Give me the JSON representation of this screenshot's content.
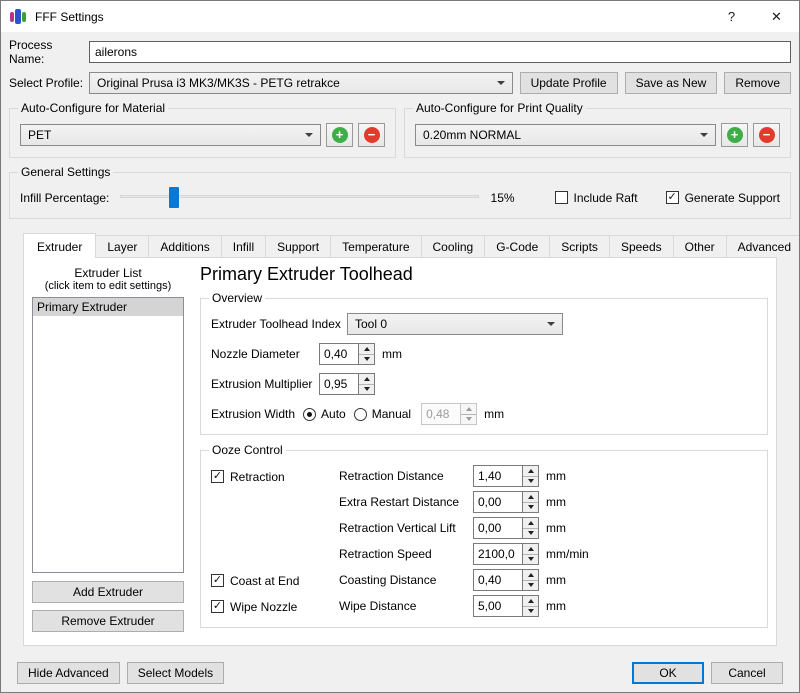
{
  "window": {
    "title": "FFF Settings",
    "help": "?",
    "close": "✕"
  },
  "process": {
    "label": "Process Name:",
    "value": "ailerons"
  },
  "profile": {
    "label": "Select Profile:",
    "value": "Original Prusa i3 MK3/MK3S - PETG retrakce",
    "update": "Update Profile",
    "save_as_new": "Save as New",
    "remove": "Remove"
  },
  "auto_material": {
    "title": "Auto-Configure for Material",
    "value": "PET",
    "add": "+",
    "remove": "−"
  },
  "auto_quality": {
    "title": "Auto-Configure for Print Quality",
    "value": "0.20mm NORMAL",
    "add": "+",
    "remove": "−"
  },
  "general": {
    "title": "General Settings",
    "infill_label": "Infill Percentage:",
    "infill_value": "15%",
    "infill_percent": 15,
    "include_raft": {
      "label": "Include Raft",
      "checked": false
    },
    "generate_support": {
      "label": "Generate Support",
      "checked": true
    }
  },
  "tabs": [
    {
      "label": "Extruder",
      "active": true
    },
    {
      "label": "Layer",
      "active": false
    },
    {
      "label": "Additions",
      "active": false
    },
    {
      "label": "Infill",
      "active": false
    },
    {
      "label": "Support",
      "active": false
    },
    {
      "label": "Temperature",
      "active": false
    },
    {
      "label": "Cooling",
      "active": false
    },
    {
      "label": "G-Code",
      "active": false
    },
    {
      "label": "Scripts",
      "active": false
    },
    {
      "label": "Speeds",
      "active": false
    },
    {
      "label": "Other",
      "active": false
    },
    {
      "label": "Advanced",
      "active": false
    }
  ],
  "extruder": {
    "list_title": "Extruder List",
    "list_subtitle": "(click item to edit settings)",
    "items": [
      {
        "label": "Primary Extruder",
        "selected": true
      }
    ],
    "add": "Add Extruder",
    "remove": "Remove Extruder",
    "heading": "Primary Extruder Toolhead",
    "overview": {
      "title": "Overview",
      "toolhead_label": "Extruder Toolhead Index",
      "toolhead_value": "Tool 0",
      "nozzle_label": "Nozzle Diameter",
      "nozzle_value": "0,40",
      "nozzle_unit": "mm",
      "multiplier_label": "Extrusion Multiplier",
      "multiplier_value": "0,95",
      "width_label": "Extrusion Width",
      "auto_label": "Auto",
      "manual_label": "Manual",
      "auto_selected": true,
      "manual_selected": false,
      "width_value": "0,48",
      "width_unit": "mm"
    },
    "ooze": {
      "title": "Ooze Control",
      "retraction": {
        "label": "Retraction",
        "checked": true
      },
      "coast": {
        "label": "Coast at End",
        "checked": true
      },
      "wipe": {
        "label": "Wipe Nozzle",
        "checked": true
      },
      "rows": [
        {
          "label": "Retraction Distance",
          "value": "1,40",
          "unit": "mm"
        },
        {
          "label": "Extra Restart Distance",
          "value": "0,00",
          "unit": "mm"
        },
        {
          "label": "Retraction Vertical Lift",
          "value": "0,00",
          "unit": "mm"
        },
        {
          "label": "Retraction Speed",
          "value": "2100,0",
          "unit": "mm/min"
        },
        {
          "label": "Coasting Distance",
          "value": "0,40",
          "unit": "mm"
        },
        {
          "label": "Wipe Distance",
          "value": "5,00",
          "unit": "mm"
        }
      ]
    }
  },
  "footer": {
    "hide_advanced": "Hide Advanced",
    "select_models": "Select Models",
    "ok": "OK",
    "cancel": "Cancel"
  },
  "colors": {
    "accent": "#0078d7",
    "slider_thumb": "#0e77d1",
    "add_green": "#3fae49",
    "remove_red": "#e23b2e",
    "logo_magenta": "#b5338a",
    "logo_blue": "#2c54c8",
    "logo_green": "#3c9e3f"
  }
}
